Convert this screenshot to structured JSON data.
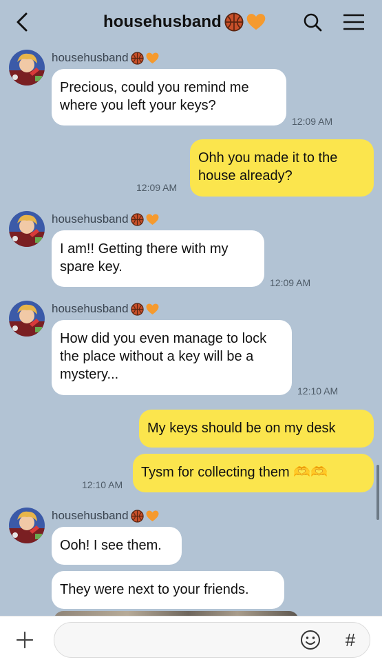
{
  "header": {
    "title": "househusband",
    "back_icon": "chevron-left-icon",
    "search_icon": "search-icon",
    "menu_icon": "hamburger-menu-icon",
    "title_emojis": [
      "basketball-emoji",
      "orange-heart-emoji"
    ]
  },
  "colors": {
    "background": "#b2c3d4",
    "incoming_bubble": "#ffffff",
    "outgoing_bubble": "#fbe54d",
    "timestamp": "#4d5a66"
  },
  "messages": [
    {
      "sender": "househusband",
      "direction": "in",
      "text": "Precious, could you remind me where you left your keys?",
      "time": "12:09 AM"
    },
    {
      "direction": "out",
      "text": "Ohh you made it to the house already?",
      "time": "12:09 AM"
    },
    {
      "sender": "househusband",
      "direction": "in",
      "text": "I am!! Getting there with my spare key.",
      "time": "12:09 AM"
    },
    {
      "sender": "househusband",
      "direction": "in",
      "text": "How did you even manage to lock the place without a key will be a mystery...",
      "time": "12:10 AM"
    },
    {
      "direction": "out",
      "text": "My keys should be on my desk"
    },
    {
      "direction": "out",
      "text": "Tysm for collecting them 🫶🫶",
      "time": "12:10 AM"
    },
    {
      "sender": "househusband",
      "direction": "in",
      "text": "Ooh! I see them."
    },
    {
      "direction": "in",
      "text": "They were next to your friends."
    }
  ],
  "input_bar": {
    "plus_icon": "plus-icon",
    "placeholder": "",
    "emoji_icon": "smiley-icon",
    "hash_label": "#"
  }
}
